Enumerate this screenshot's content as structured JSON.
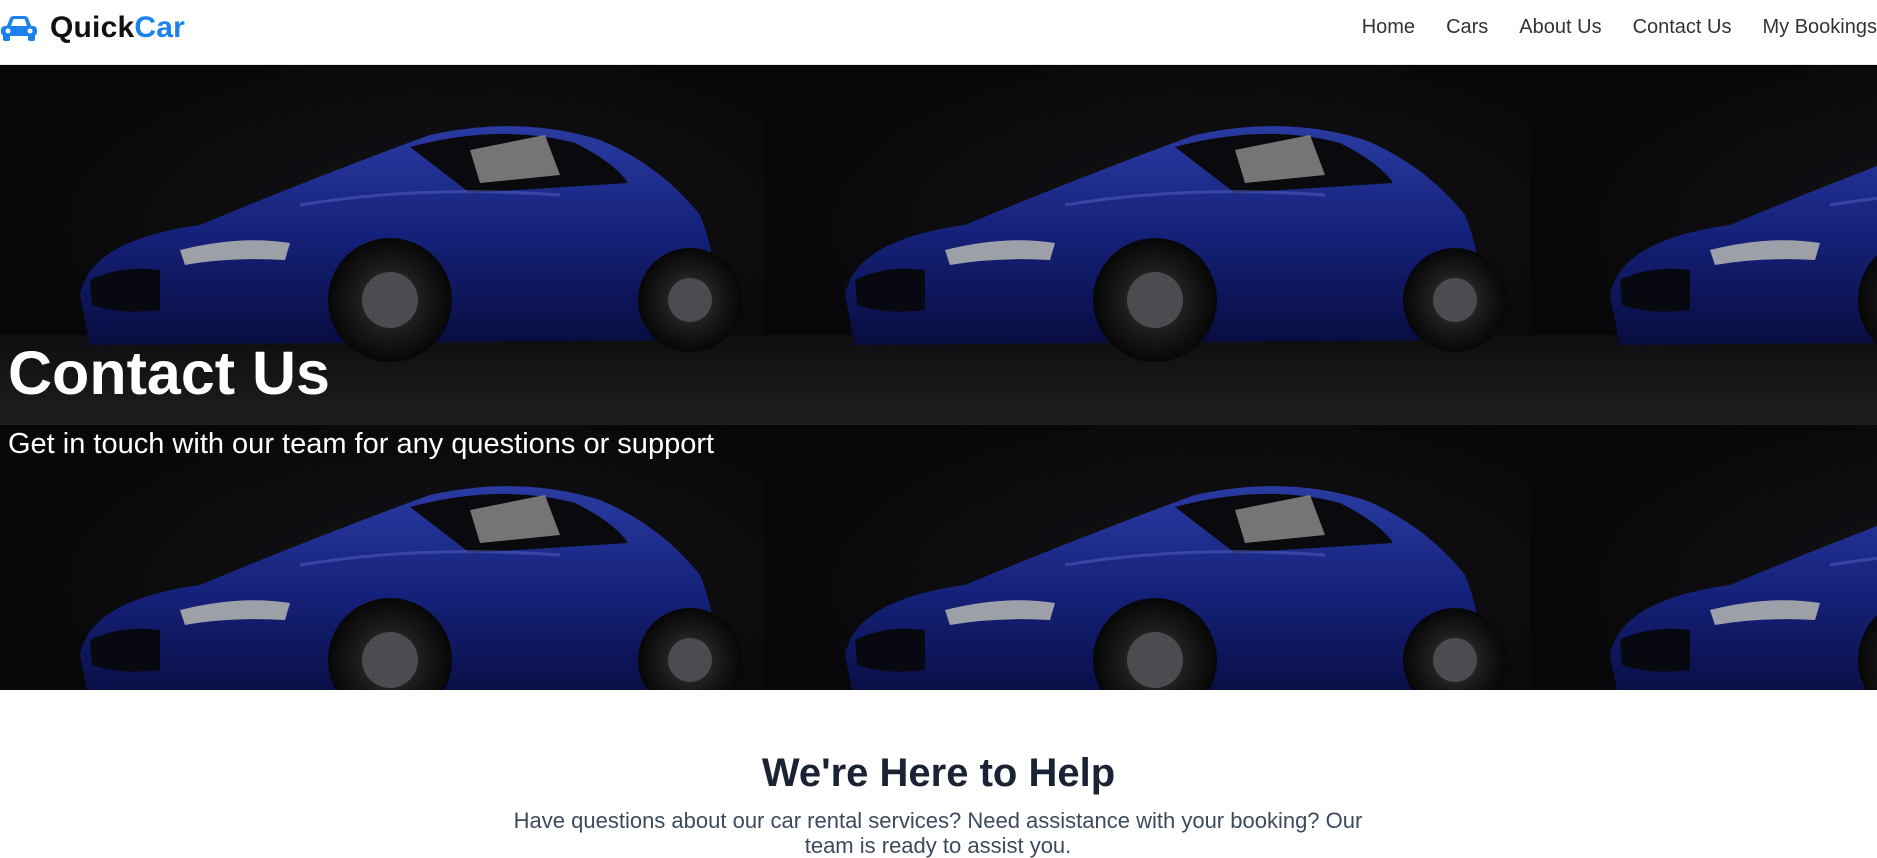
{
  "brand": {
    "name_part1": "Quick",
    "name_part2": "Car",
    "icon": "car-icon",
    "accent_color": "#1a82ee"
  },
  "nav": {
    "items": [
      {
        "label": "Home"
      },
      {
        "label": "Cars"
      },
      {
        "label": "About Us"
      },
      {
        "label": "Contact Us"
      },
      {
        "label": "My Bookings"
      }
    ]
  },
  "hero": {
    "title": "Contact Us",
    "subtitle": "Get in touch with our team for any questions or support",
    "background_image": "blue-sports-car-tiled"
  },
  "help": {
    "title": "We're Here to Help",
    "text": "Have questions about our car rental services? Need assistance with your booking? Our team is ready to assist you."
  }
}
